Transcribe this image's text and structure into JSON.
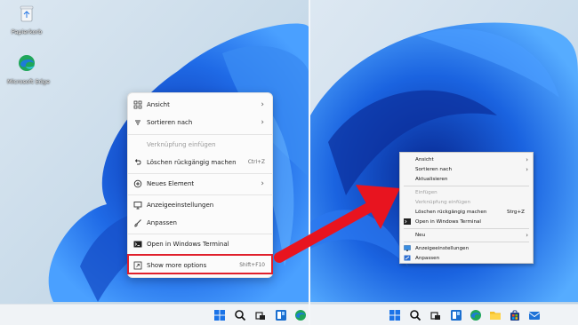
{
  "desktop": {
    "icons": [
      {
        "label": "Papierkorb",
        "icon": "recycle-bin-icon"
      },
      {
        "label": "Microsoft Edge",
        "icon": "edge-icon"
      }
    ]
  },
  "menu_new": {
    "items": [
      {
        "label": "Ansicht",
        "icon": "grid-icon",
        "submenu": true
      },
      {
        "label": "Sortieren nach",
        "icon": "sort-icon",
        "submenu": true
      },
      {
        "label": "Verknüpfung einfügen",
        "disabled": true
      },
      {
        "label": "Löschen rückgängig machen",
        "icon": "undo-icon",
        "shortcut": "Ctrl+Z"
      },
      {
        "label": "Neues Element",
        "icon": "new-item-icon",
        "submenu": true
      },
      {
        "label": "Anzeigeeinstellungen",
        "icon": "display-icon"
      },
      {
        "label": "Anpassen",
        "icon": "brush-icon"
      },
      {
        "label": "Open in Windows Terminal",
        "icon": "terminal-icon"
      },
      {
        "label": "Show more options",
        "icon": "more-options-icon",
        "shortcut": "Shift+F10"
      }
    ]
  },
  "menu_classic": {
    "items": [
      {
        "label": "Ansicht",
        "submenu": true
      },
      {
        "label": "Sortieren nach",
        "submenu": true
      },
      {
        "label": "Aktualisieren"
      },
      {
        "label": "Einfügen",
        "disabled": true
      },
      {
        "label": "Verknüpfung einfügen",
        "disabled": true
      },
      {
        "label": "Löschen rückgängig machen",
        "shortcut": "Strg+Z"
      },
      {
        "label": "Open in Windows Terminal",
        "icon": "terminal-icon"
      },
      {
        "label": "Neu",
        "submenu": true
      },
      {
        "label": "Anzeigeeinstellungen",
        "icon": "display-icon"
      },
      {
        "label": "Anpassen",
        "icon": "personalize-icon"
      }
    ]
  },
  "colors": {
    "highlight": "#e0202c",
    "arrow": "#e8141f",
    "wallpaper_blue": "#1a5fd6"
  }
}
